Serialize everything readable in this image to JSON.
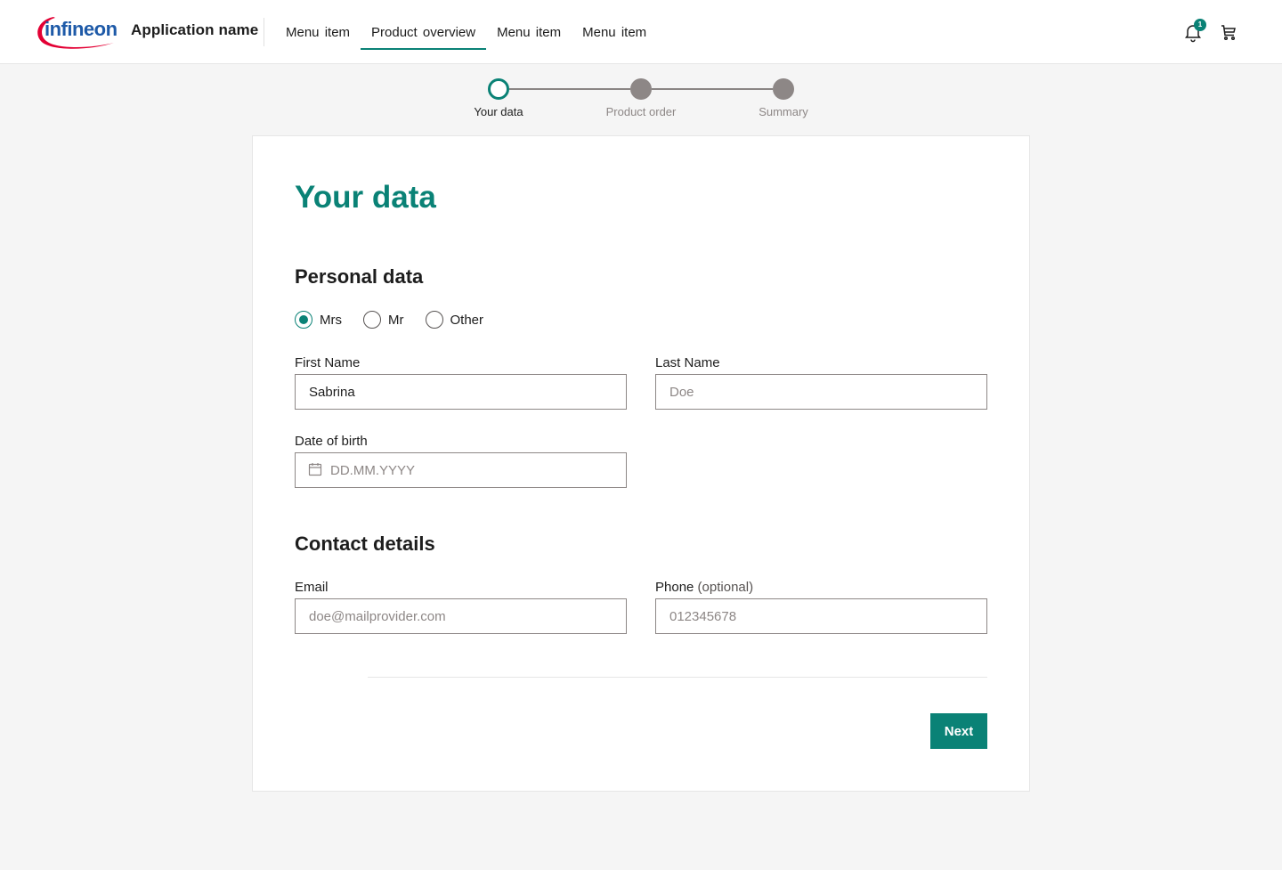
{
  "header": {
    "logo_text": "infineon",
    "app_name": "Application name",
    "nav": [
      {
        "label": "Menu  item",
        "active": false
      },
      {
        "label": "Product overview",
        "active": true
      },
      {
        "label": "Menu  item",
        "active": false
      },
      {
        "label": "Menu  item",
        "active": false
      }
    ],
    "notification_count": "1"
  },
  "stepper": {
    "steps": [
      {
        "label": "Your data",
        "state": "current"
      },
      {
        "label": "Product order",
        "state": "todo"
      },
      {
        "label": "Summary",
        "state": "todo"
      }
    ]
  },
  "form": {
    "title": "Your data",
    "personal_section": "Personal data",
    "salutation": {
      "options": [
        "Mrs",
        "Mr",
        "Other"
      ],
      "selected": "Mrs"
    },
    "first_name": {
      "label": "First Name",
      "value": "Sabrina",
      "placeholder": ""
    },
    "last_name": {
      "label": "Last Name",
      "value": "",
      "placeholder": "Doe"
    },
    "dob": {
      "label": "Date of birth",
      "value": "",
      "placeholder": "DD.MM.YYYY"
    },
    "contact_section": "Contact details",
    "email": {
      "label": "Email",
      "value": "",
      "placeholder": "doe@mailprovider.com"
    },
    "phone": {
      "label": "Phone",
      "optional": "(optional)",
      "value": "",
      "placeholder": "012345678"
    },
    "next_label": "Next"
  },
  "colors": {
    "brand_green": "#0a8276",
    "step_inactive": "#8d8786",
    "logo_blue": "#1e5aa8",
    "logo_red": "#e30034"
  }
}
